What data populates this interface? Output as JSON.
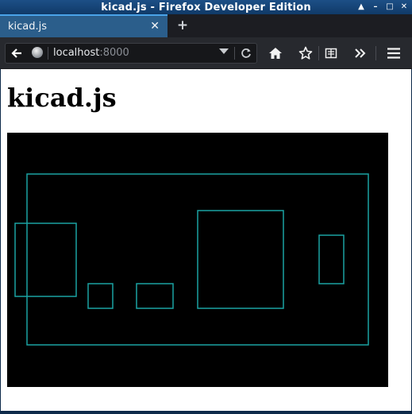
{
  "window": {
    "title": "kicad.js - Firefox Developer Edition",
    "controls": [
      "minimize",
      "restore",
      "maximize",
      "close"
    ]
  },
  "tabs": [
    {
      "label": "kicad.js",
      "active": true
    }
  ],
  "new_tab_label": "+",
  "urlbar": {
    "host": "localhost",
    "port": ":8000"
  },
  "toolbar_icons": [
    "home-icon",
    "bookmark-star-icon",
    "reading-list-icon",
    "overflow-chevron-icon",
    "hamburger-menu-icon"
  ],
  "page": {
    "heading": "kicad.js"
  },
  "colors": {
    "canvas_background": "#000000",
    "outline_stroke": "#1aa3a3",
    "tab_active": "#2b5e8b",
    "titlebar": "#1c4f86"
  }
}
